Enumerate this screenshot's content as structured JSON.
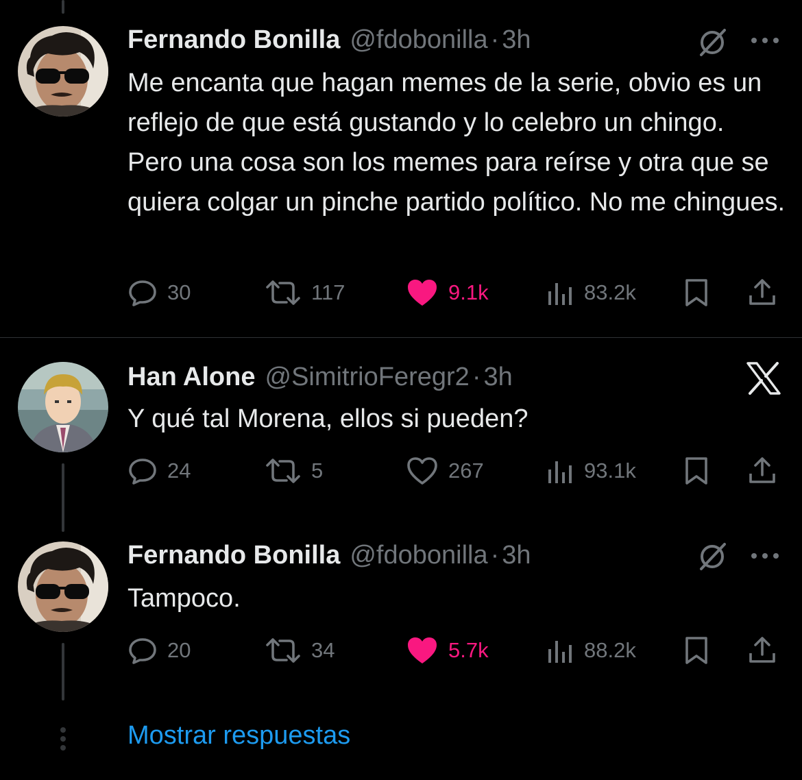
{
  "tweets": [
    {
      "name": "Fernando Bonilla",
      "handle": "@fdobonilla",
      "dot": "·",
      "time": "3h",
      "text": "Me encanta que hagan memes de la serie, obvio es un reflejo de que está gustando y lo celebro un chingo. Pero una cosa son los memes para reírse y otra que se quiera colgar un pinche partido político. No me chingues.",
      "replies": "30",
      "retweets": "117",
      "likes": "9.1k",
      "liked": true,
      "views": "83.2k"
    },
    {
      "name": "Han Alone",
      "handle": "@SimitrioFeregr2",
      "dot": "·",
      "time": "3h",
      "text": "Y qué tal Morena, ellos si pueden?",
      "replies": "24",
      "retweets": "5",
      "likes": "267",
      "liked": false,
      "views": "93.1k"
    },
    {
      "name": "Fernando Bonilla",
      "handle": "@fdobonilla",
      "dot": "·",
      "time": "3h",
      "text": "Tampoco.",
      "replies": "20",
      "retweets": "34",
      "likes": "5.7k",
      "liked": true,
      "views": "88.2k"
    }
  ],
  "show_replies_label": "Mostrar respuestas",
  "icons": {
    "grok": "grok-icon",
    "more": "more-icon",
    "x_logo": "x-logo-icon",
    "reply": "reply-icon",
    "retweet": "retweet-icon",
    "like": "heart-icon",
    "views": "views-icon",
    "bookmark": "bookmark-icon",
    "share": "share-icon"
  },
  "colors": {
    "background": "#000000",
    "text": "#e7e9ea",
    "muted": "#71767b",
    "like": "#f91880",
    "link": "#1d9bf0"
  }
}
